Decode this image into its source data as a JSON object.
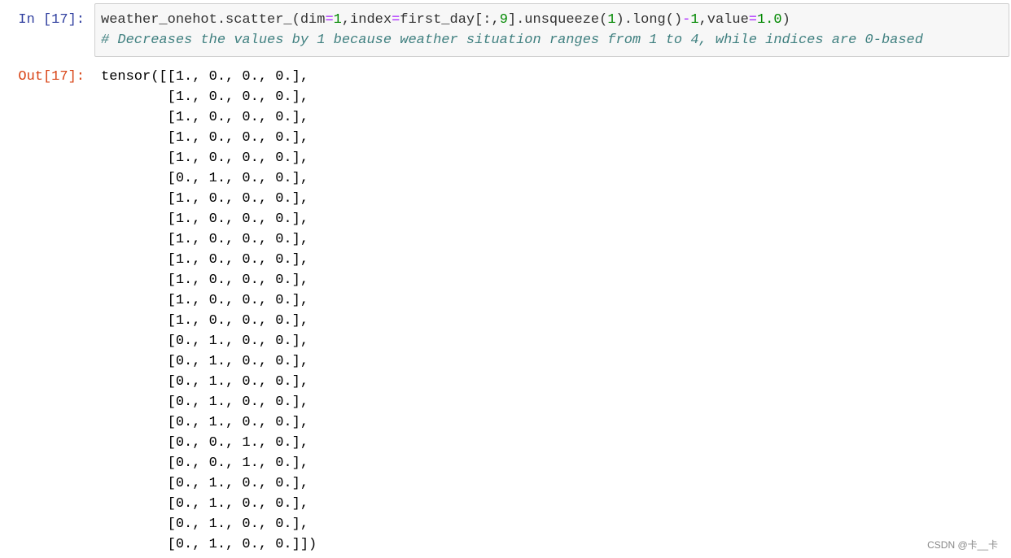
{
  "input": {
    "prompt": "In  [17]:",
    "code_parts": [
      "weather_onehot.scatter_(dim",
      "=",
      "1",
      ",index",
      "=",
      "first_day[:,",
      "9",
      "].unsqueeze(",
      "1",
      ").long()",
      "-",
      "1",
      ",value",
      "=",
      "1.0",
      ")"
    ],
    "comment": "# Decreases the values by 1 because weather situation ranges from 1 to 4, while indices are 0-based"
  },
  "output": {
    "prompt": "Out[17]:",
    "lines": [
      "tensor([[1., 0., 0., 0.],",
      "        [1., 0., 0., 0.],",
      "        [1., 0., 0., 0.],",
      "        [1., 0., 0., 0.],",
      "        [1., 0., 0., 0.],",
      "        [0., 1., 0., 0.],",
      "        [1., 0., 0., 0.],",
      "        [1., 0., 0., 0.],",
      "        [1., 0., 0., 0.],",
      "        [1., 0., 0., 0.],",
      "        [1., 0., 0., 0.],",
      "        [1., 0., 0., 0.],",
      "        [1., 0., 0., 0.],",
      "        [0., 1., 0., 0.],",
      "        [0., 1., 0., 0.],",
      "        [0., 1., 0., 0.],",
      "        [0., 1., 0., 0.],",
      "        [0., 1., 0., 0.],",
      "        [0., 0., 1., 0.],",
      "        [0., 0., 1., 0.],",
      "        [0., 1., 0., 0.],",
      "        [0., 1., 0., 0.],",
      "        [0., 1., 0., 0.],",
      "        [0., 1., 0., 0.]])"
    ]
  },
  "watermark": "CSDN @卡__卡"
}
